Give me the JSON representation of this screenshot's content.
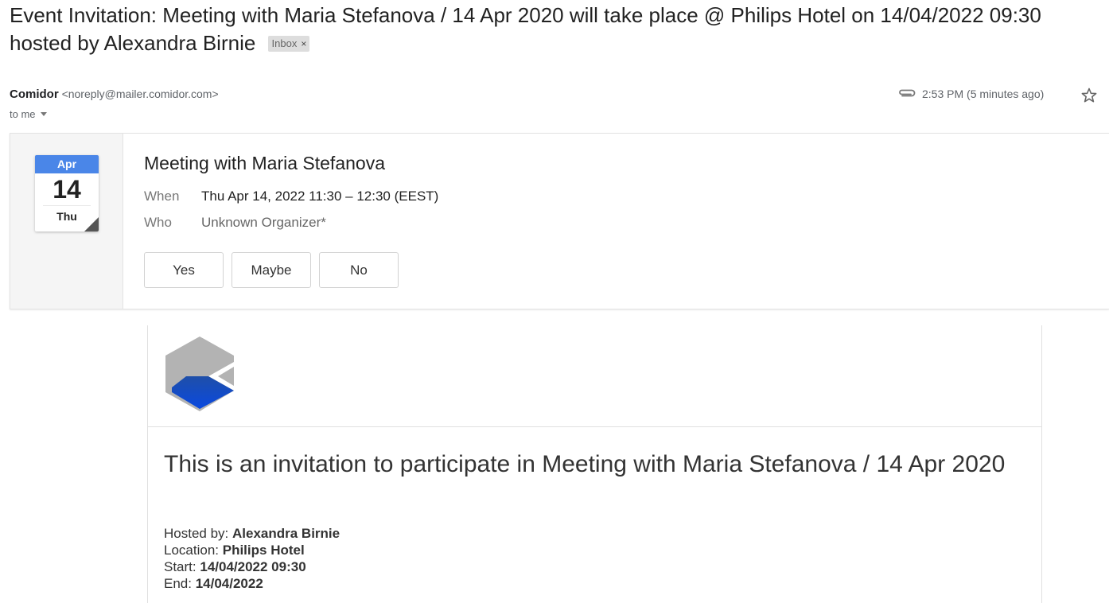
{
  "email": {
    "subject": "Event Invitation: Meeting with Maria Stefanova / 14 Apr 2020 will take place @ Philips Hotel on 14/04/2022 09:30 hosted by Alexandra Birnie",
    "label": "Inbox",
    "label_close": "×",
    "sender_name": "Comidor",
    "sender_email": "<noreply@mailer.comidor.com>",
    "recipient": "to me",
    "time": "2:53 PM (5 minutes ago)"
  },
  "calendar_card": {
    "month": "Apr",
    "day": "14",
    "weekday": "Thu",
    "title": "Meeting with Maria Stefanova",
    "when_label": "When",
    "when_value": "Thu Apr 14, 2022 11:30 – 12:30 (EEST)",
    "who_label": "Who",
    "who_value": "Unknown Organizer*",
    "rsvp": {
      "yes": "Yes",
      "maybe": "Maybe",
      "no": "No"
    }
  },
  "body": {
    "heading": "This is an invitation to participate in Meeting with Maria Stefanova / 14 Apr 2020",
    "hosted_label": "Hosted by: ",
    "hosted_value": "Alexandra Birnie",
    "location_label": "Location: ",
    "location_value": "Philips Hotel",
    "start_label": "Start: ",
    "start_value": "14/04/2022 09:30",
    "end_label": "End: ",
    "end_value": "14/04/2022"
  },
  "icons": {
    "attachment": "paperclip-icon",
    "star": "star-icon",
    "logo": "comidor-logo"
  },
  "colors": {
    "calendar_month_bg": "#4a86e8",
    "logo_blue": "#0a49c4",
    "logo_gray": "#b3b3b3"
  }
}
